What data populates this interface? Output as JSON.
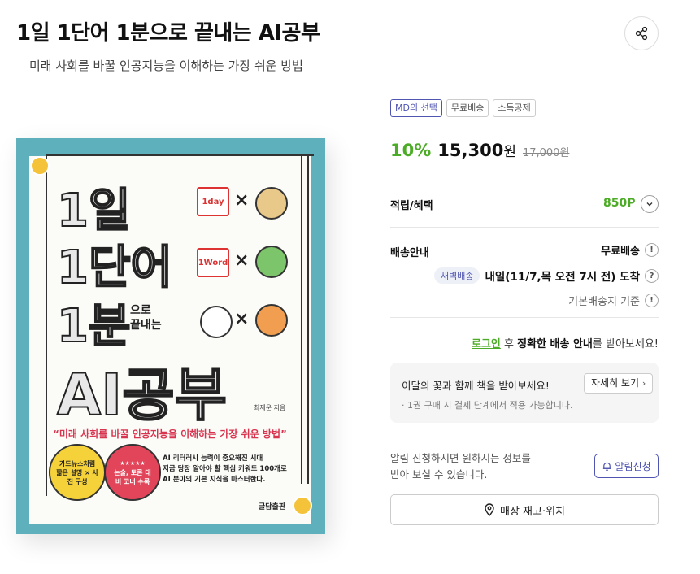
{
  "header": {
    "title": "1일 1단어 1분으로 끝내는 AI공부",
    "subtitle": "미래 사회를 바꿀 인공지능을 이해하는 가장 쉬운 방법",
    "share_icon": "share-icon"
  },
  "cover": {
    "line1": "1일",
    "line2": "1단어",
    "line3": "1분",
    "line3_small_a": "으로",
    "line3_small_b": "끝내는",
    "line4": "AI공부",
    "icon1_label": "1day",
    "icon2_label": "1Word",
    "author": "최재운 지음",
    "quote": "“미래 사회를 바꿀 인공지능을 이해하는 가장 쉬운 방법”",
    "circle_yellow": "카드뉴스처럼 짧은 설명 × 사진 구성",
    "circle_red_stars": "★★★★★",
    "circle_red": "논술, 토론 대비 코너 수록",
    "desc_1": "AI 리터러시 능력이 중요해진 시대",
    "desc_2": "지금 당장 알아야 할 핵심 키워드 100개로",
    "desc_3": "AI 분야의 기본 지식을 마스터한다.",
    "publisher": "글담출판",
    "bg_color": "#5fb0bd"
  },
  "tags": [
    "MD의 선택",
    "무료배송",
    "소득공제"
  ],
  "price": {
    "discount": "10%",
    "amount": "15,300",
    "unit": "원",
    "original": "17,000원"
  },
  "benefit": {
    "label": "적립/혜택",
    "points": "850P"
  },
  "shipping": {
    "label": "배송안내",
    "free": "무료배송",
    "dawn_tag": "새벽배송",
    "arrival": "내일(11/7,목 오전 7시 전) 도착",
    "base": "기본배송지 기준",
    "info_mark": "!",
    "help_mark": "?"
  },
  "login_prompt": {
    "link": "로그인",
    "mid": " 후 ",
    "bold": "정확한 배송 안내",
    "tail": "를 받아보세요!"
  },
  "promo": {
    "title": "이달의 꽃과 함께 책을 받아보세요!",
    "note": "· 1권 구매 시 결제 단계에서 적용 가능합니다.",
    "button": "자세히 보기"
  },
  "alarm": {
    "text_1": "알림 신청하시면 원하시는 정보를",
    "text_2": "받아 보실 수 있습니다.",
    "button": "알림신청"
  },
  "store": {
    "button": "매장 재고·위치"
  },
  "colors": {
    "accent_green": "#4dac27",
    "accent_blue": "#5055b1",
    "cover_red": "#d9344f"
  }
}
